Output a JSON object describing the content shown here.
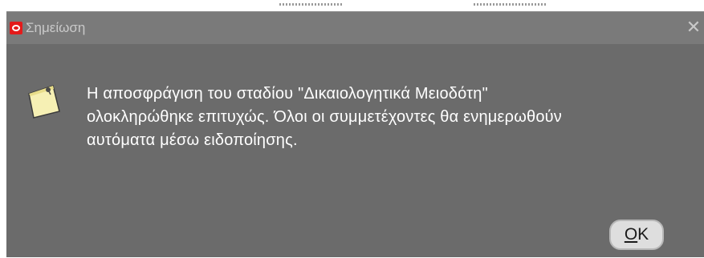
{
  "dialog": {
    "title": "Σημείωση",
    "message_lines": [
      "Η αποσφράγιση του σταδίου \"Δικαιολογητικά Μειοδότη\"",
      "ολοκληρώθηκε επιτυχώς. Όλοι οι συμμετέχοντες θα ενημερωθούν",
      "αυτόματα μέσω ειδοποίησης."
    ],
    "ok_button": {
      "mnemonic": "O",
      "rest": "K"
    },
    "close_glyph": "✕"
  },
  "icons": {
    "title_logo": "oracle-logo-icon",
    "note": "note-icon",
    "close": "close-icon"
  },
  "colors": {
    "dialog_background": "#6b6b6b",
    "title_bar": "#7a7a7a",
    "title_text": "#c9c9c9",
    "message_text": "#ffffff",
    "button_face": "#dedede",
    "logo_red": "#e31b1b",
    "note_yellow": "#f6f0b4"
  }
}
